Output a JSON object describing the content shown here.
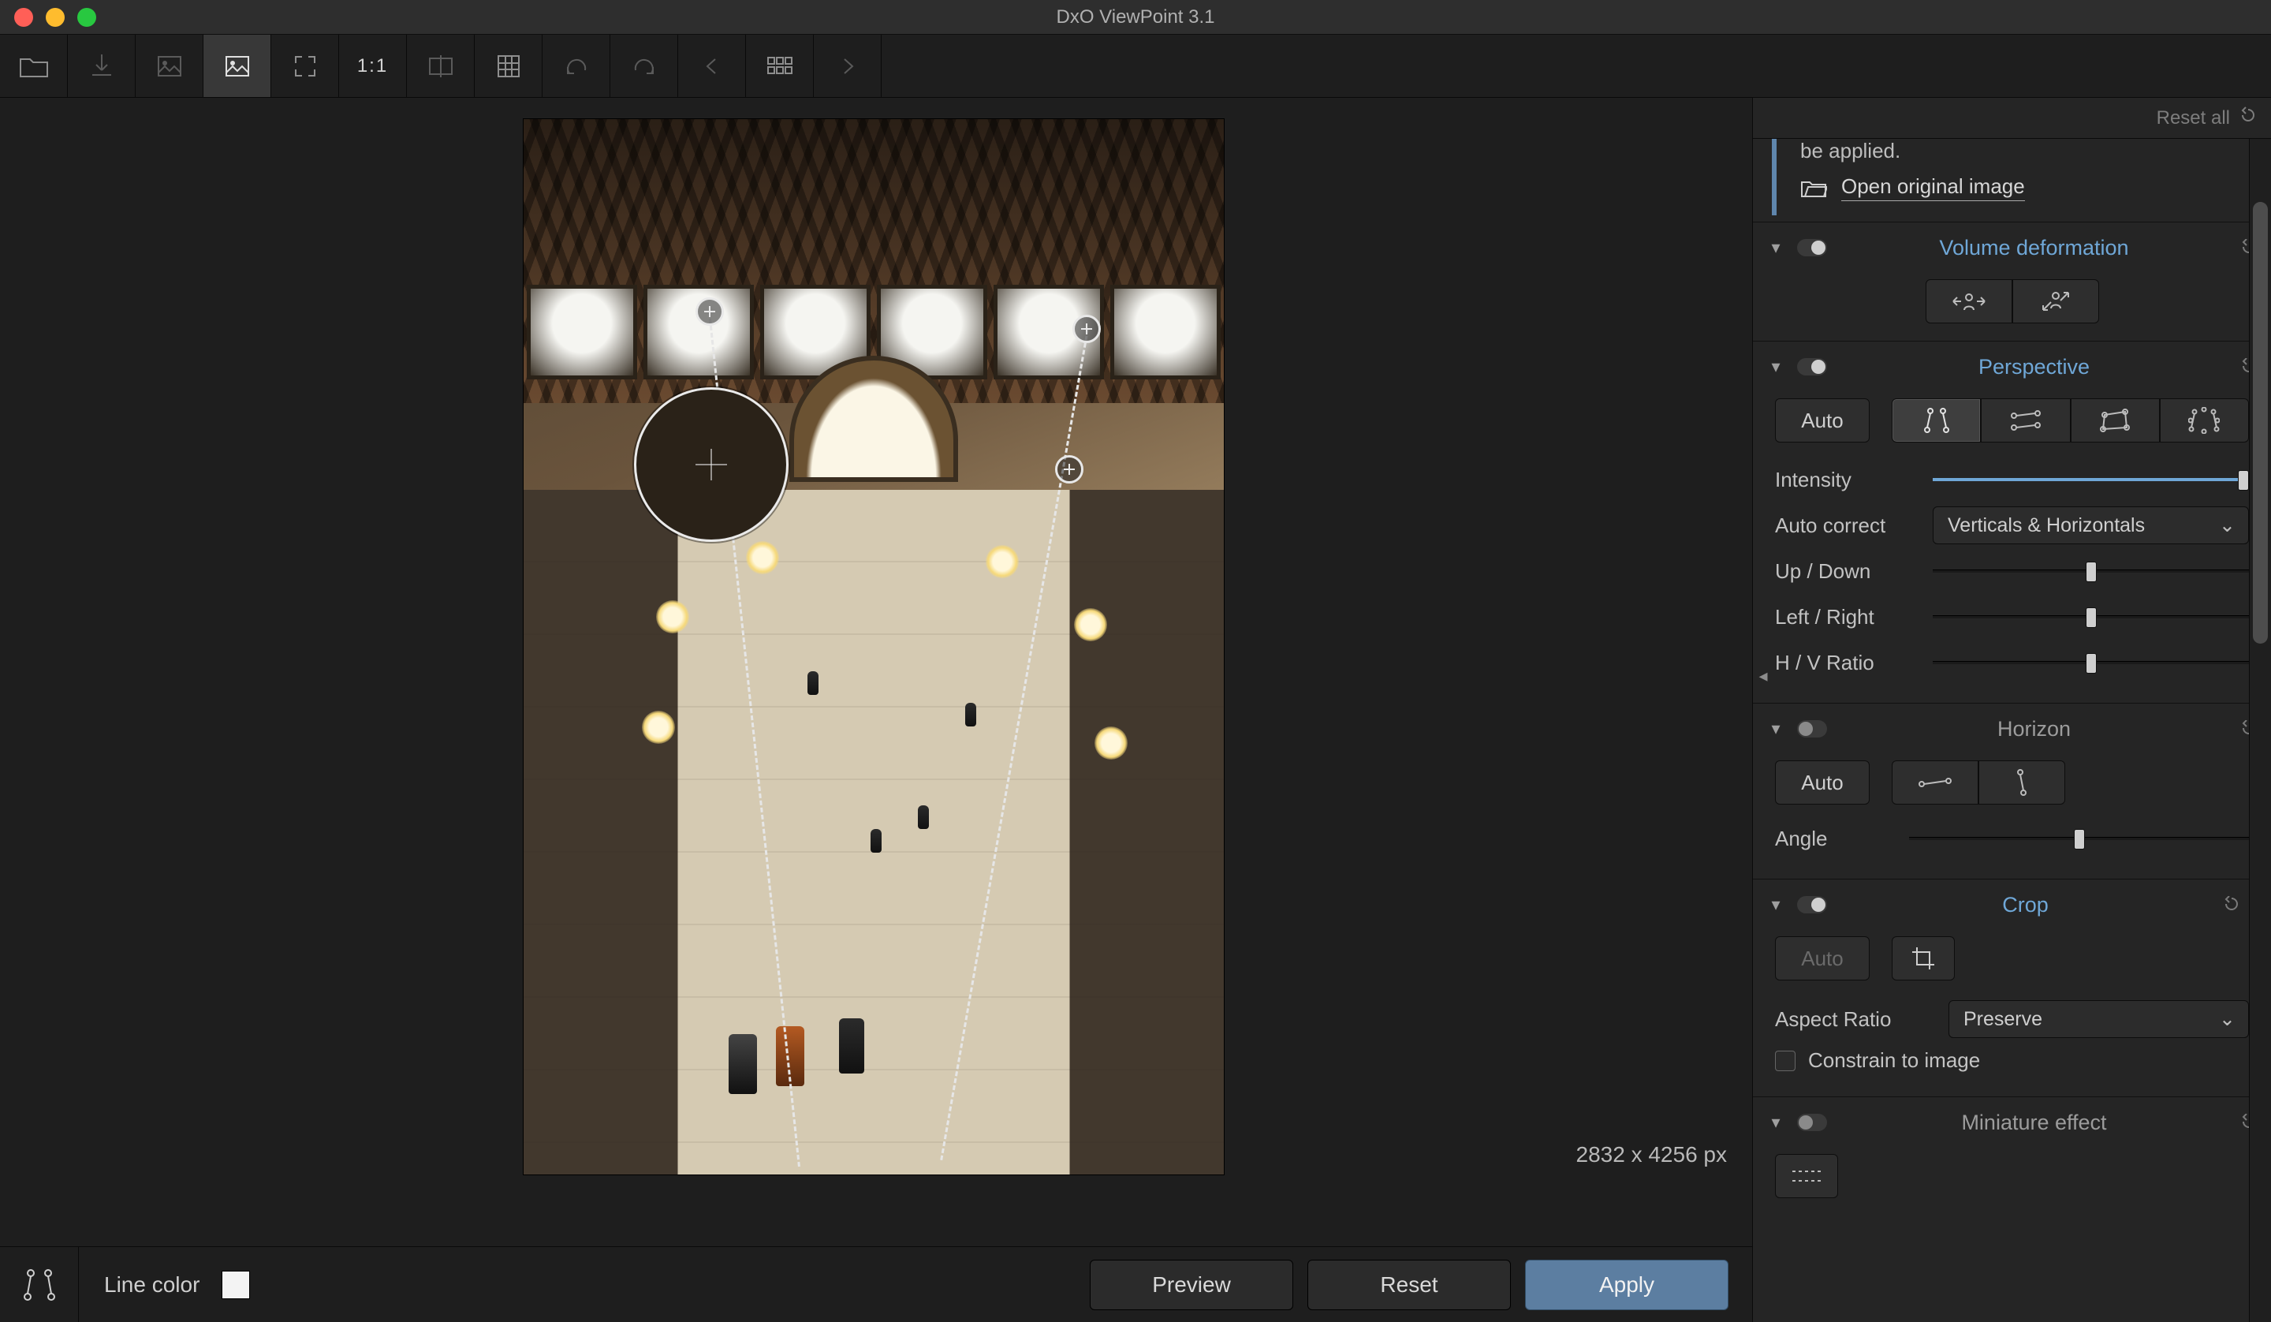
{
  "app": {
    "title": "DxO ViewPoint 3.1"
  },
  "toolbar": {
    "zoom_label": "1:1"
  },
  "canvas": {
    "dimensions": "2832 x 4256 px"
  },
  "bottom": {
    "line_color_label": "Line color",
    "line_color_value": "#f3f3f3",
    "preview": "Preview",
    "reset": "Reset",
    "apply": "Apply"
  },
  "panel_top": {
    "reset_all": "Reset all"
  },
  "note": {
    "truncated_text": "be applied.",
    "open_link": "Open original image"
  },
  "sections": {
    "volume": {
      "title": "Volume deformation",
      "enabled": true,
      "accent": true
    },
    "perspective": {
      "title": "Perspective",
      "enabled": true,
      "accent": true
    },
    "horizon": {
      "title": "Horizon",
      "enabled": false,
      "accent": false
    },
    "crop": {
      "title": "Crop",
      "enabled": true,
      "accent": true
    },
    "miniature": {
      "title": "Miniature effect",
      "enabled": false,
      "accent": false
    }
  },
  "perspective": {
    "auto": "Auto",
    "intensity_label": "Intensity",
    "intensity_value": 100,
    "auto_correct_label": "Auto correct",
    "auto_correct_value": "Verticals & Horizontals",
    "updown_label": "Up / Down",
    "updown_value": 50,
    "leftright_label": "Left / Right",
    "leftright_value": 50,
    "hvratio_label": "H / V Ratio",
    "hvratio_value": 50
  },
  "horizon": {
    "auto": "Auto",
    "angle_label": "Angle",
    "angle_value": 50
  },
  "crop": {
    "auto": "Auto",
    "aspect_label": "Aspect Ratio",
    "aspect_value": "Preserve",
    "constrain_label": "Constrain to image",
    "constrain_checked": false
  }
}
